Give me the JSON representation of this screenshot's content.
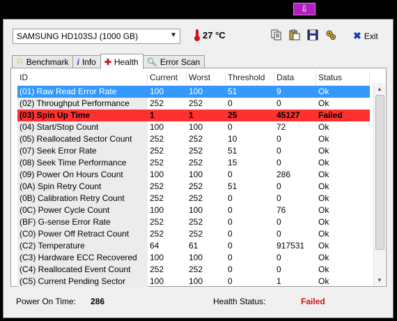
{
  "top_button_icon": "download-arrow-icon",
  "drive": {
    "selected": "SAMSUNG HD103SJ (1000 GB)"
  },
  "temperature": "27 °C",
  "toolbar": {
    "exit_label": "Exit"
  },
  "tabs": [
    {
      "label": "Benchmark",
      "icon": "benchmark-icon"
    },
    {
      "label": "Info",
      "icon": "info-icon"
    },
    {
      "label": "Health",
      "icon": "health-cross-icon"
    },
    {
      "label": "Error Scan",
      "icon": "magnifier-icon"
    }
  ],
  "table": {
    "columns": [
      "ID",
      "Current",
      "Worst",
      "Threshold",
      "Data",
      "Status"
    ],
    "rows": [
      [
        "(01) Raw Read Error Rate",
        "100",
        "100",
        "51",
        "9",
        "Ok"
      ],
      [
        "(02) Throughput Performance",
        "252",
        "252",
        "0",
        "0",
        "Ok"
      ],
      [
        "(03) Spin Up Time",
        "1",
        "1",
        "25",
        "45127",
        "Failed"
      ],
      [
        "(04) Start/Stop Count",
        "100",
        "100",
        "0",
        "72",
        "Ok"
      ],
      [
        "(05) Reallocated Sector Count",
        "252",
        "252",
        "10",
        "0",
        "Ok"
      ],
      [
        "(07) Seek Error Rate",
        "252",
        "252",
        "51",
        "0",
        "Ok"
      ],
      [
        "(08) Seek Time Performance",
        "252",
        "252",
        "15",
        "0",
        "Ok"
      ],
      [
        "(09) Power On Hours Count",
        "100",
        "100",
        "0",
        "286",
        "Ok"
      ],
      [
        "(0A) Spin Retry Count",
        "252",
        "252",
        "51",
        "0",
        "Ok"
      ],
      [
        "(0B) Calibration Retry Count",
        "252",
        "252",
        "0",
        "0",
        "Ok"
      ],
      [
        "(0C) Power Cycle Count",
        "100",
        "100",
        "0",
        "76",
        "Ok"
      ],
      [
        "(BF) G-sense Error Rate",
        "252",
        "252",
        "0",
        "0",
        "Ok"
      ],
      [
        "(C0) Power Off Retract Count",
        "252",
        "252",
        "0",
        "0",
        "Ok"
      ],
      [
        "(C2) Temperature",
        "64",
        "61",
        "0",
        "917531",
        "Ok"
      ],
      [
        "(C3) Hardware ECC Recovered",
        "100",
        "100",
        "0",
        "0",
        "Ok"
      ],
      [
        "(C4) Reallocated Event Count",
        "252",
        "252",
        "0",
        "0",
        "Ok"
      ],
      [
        "(C5) Current Pending Sector",
        "100",
        "100",
        "0",
        "1",
        "Ok"
      ]
    ]
  },
  "status_bar": {
    "power_on_label": "Power On Time:",
    "power_on_value": "286",
    "health_label": "Health Status:",
    "health_value": "Failed"
  }
}
